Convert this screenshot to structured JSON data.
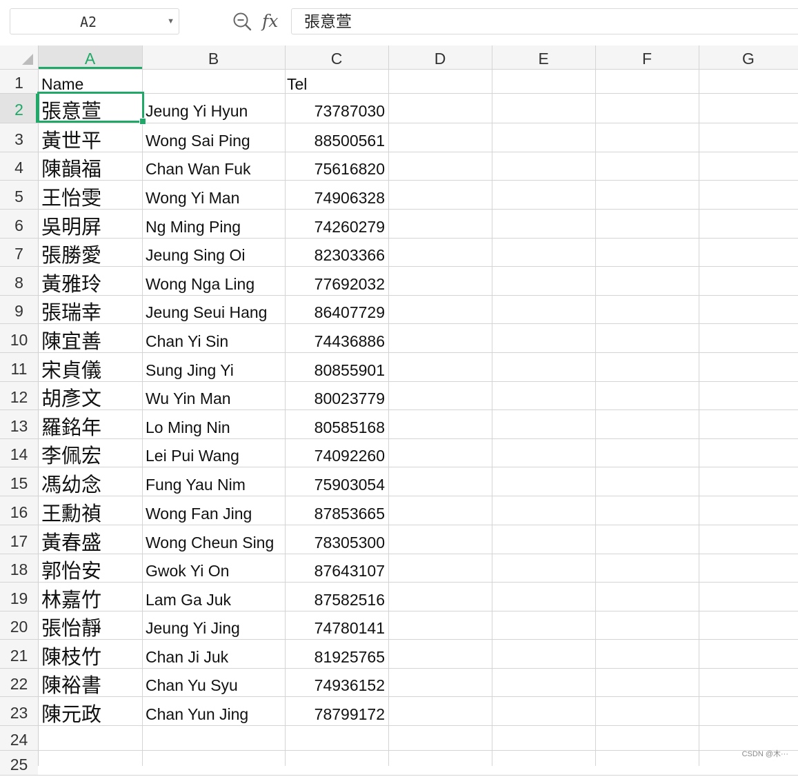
{
  "name_box": {
    "cell_ref": "A2"
  },
  "formula_bar": {
    "fx_label": "fx",
    "content": "張意萱"
  },
  "columns": [
    "A",
    "B",
    "C",
    "D",
    "E",
    "F",
    "G"
  ],
  "selected": {
    "column": "A",
    "row": 2
  },
  "header_row": {
    "name": "Name",
    "english": "",
    "tel": "Tel"
  },
  "rows": [
    {
      "row": 2,
      "name": "張意萱",
      "english": "Jeung Yi Hyun",
      "tel": "73787030"
    },
    {
      "row": 3,
      "name": "黃世平",
      "english": "Wong Sai Ping",
      "tel": "88500561"
    },
    {
      "row": 4,
      "name": "陳韻福",
      "english": "Chan Wan Fuk",
      "tel": "75616820"
    },
    {
      "row": 5,
      "name": "王怡雯",
      "english": "Wong Yi Man",
      "tel": "74906328"
    },
    {
      "row": 6,
      "name": "吳明屏",
      "english": "Ng Ming Ping",
      "tel": "74260279"
    },
    {
      "row": 7,
      "name": "張勝愛",
      "english": "Jeung Sing Oi",
      "tel": "82303366"
    },
    {
      "row": 8,
      "name": "黃雅玲",
      "english": "Wong Nga Ling",
      "tel": "77692032"
    },
    {
      "row": 9,
      "name": "張瑞幸",
      "english": "Jeung Seui Hang",
      "tel": "86407729"
    },
    {
      "row": 10,
      "name": "陳宜善",
      "english": "Chan Yi Sin",
      "tel": "74436886"
    },
    {
      "row": 11,
      "name": "宋貞儀",
      "english": "Sung Jing Yi",
      "tel": "80855901"
    },
    {
      "row": 12,
      "name": "胡彥文",
      "english": "Wu Yin Man",
      "tel": "80023779"
    },
    {
      "row": 13,
      "name": "羅銘年",
      "english": "Lo Ming Nin",
      "tel": "80585168"
    },
    {
      "row": 14,
      "name": "李佩宏",
      "english": "Lei Pui Wang",
      "tel": "74092260"
    },
    {
      "row": 15,
      "name": "馮幼念",
      "english": "Fung Yau Nim",
      "tel": "75903054"
    },
    {
      "row": 16,
      "name": "王勳禎",
      "english": "Wong Fan Jing",
      "tel": "87853665"
    },
    {
      "row": 17,
      "name": "黃春盛",
      "english": "Wong Cheun Sing",
      "tel": "78305300"
    },
    {
      "row": 18,
      "name": "郭怡安",
      "english": "Gwok Yi On",
      "tel": "87643107"
    },
    {
      "row": 19,
      "name": "林嘉竹",
      "english": "Lam Ga Juk",
      "tel": "87582516"
    },
    {
      "row": 20,
      "name": "張怡靜",
      "english": "Jeung Yi Jing",
      "tel": "74780141"
    },
    {
      "row": 21,
      "name": "陳枝竹",
      "english": "Chan Ji Juk",
      "tel": "81925765"
    },
    {
      "row": 22,
      "name": "陳裕書",
      "english": "Chan Yu Syu",
      "tel": "74936152"
    },
    {
      "row": 23,
      "name": "陳元政",
      "english": "Chan Yun Jing",
      "tel": "78799172"
    }
  ],
  "empty_rows": [
    24,
    25
  ],
  "watermark": "CSDN @木···"
}
